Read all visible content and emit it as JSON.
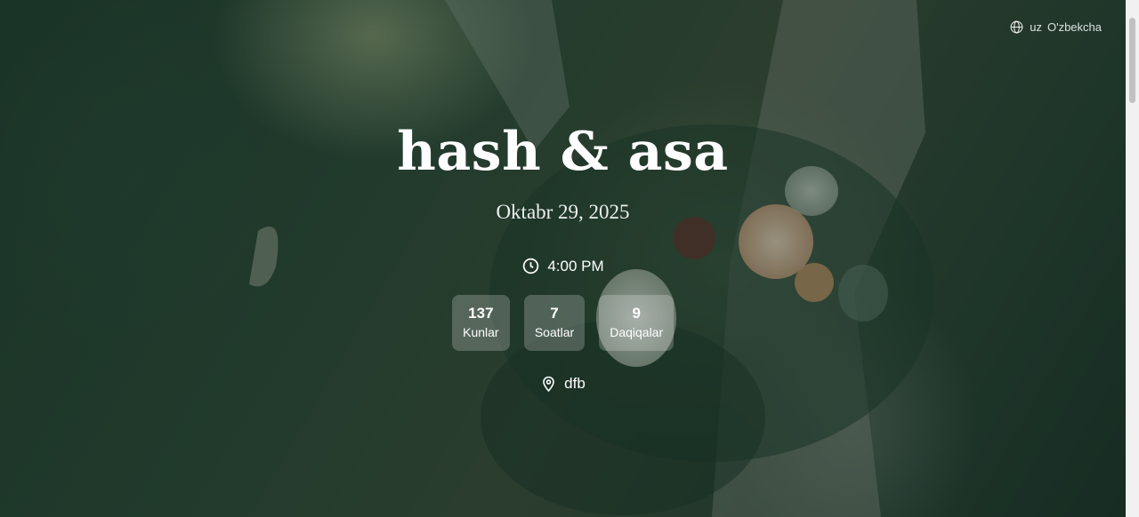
{
  "language": {
    "code": "uz",
    "name": "O'zbekcha",
    "icon": "globe-icon"
  },
  "event": {
    "title": "hash & asa",
    "date": "Oktabr 29, 2025",
    "time": "4:00 PM",
    "time_icon": "clock-icon",
    "location": "dfb",
    "location_icon": "map-pin-icon"
  },
  "countdown": [
    {
      "value": "137",
      "label": "Kunlar"
    },
    {
      "value": "7",
      "label": "Soatlar"
    },
    {
      "value": "9",
      "label": "Daqiqalar"
    }
  ],
  "colors": {
    "overlay": "#12281e",
    "text": "#ffffff"
  }
}
